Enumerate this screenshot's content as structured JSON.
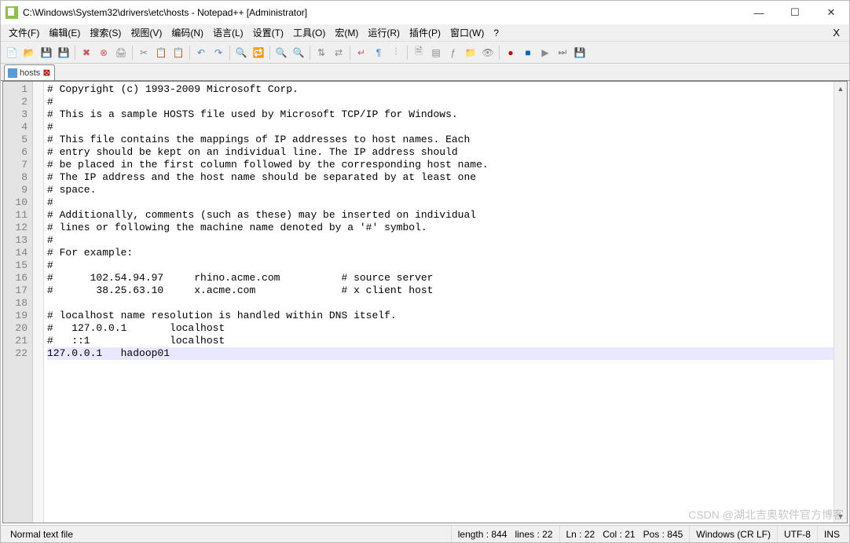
{
  "window": {
    "title": "C:\\Windows\\System32\\drivers\\etc\\hosts - Notepad++ [Administrator]"
  },
  "menubar": {
    "items": [
      "文件(F)",
      "编辑(E)",
      "搜索(S)",
      "视图(V)",
      "编码(N)",
      "语言(L)",
      "设置(T)",
      "工具(O)",
      "宏(M)",
      "运行(R)",
      "插件(P)",
      "窗口(W)",
      "?"
    ],
    "help_x": "X"
  },
  "toolbar": {
    "icons": [
      {
        "name": "new-file-icon",
        "glyph": "📄",
        "color": "#6b9"
      },
      {
        "name": "open-file-icon",
        "glyph": "📂",
        "color": "#e9a23b"
      },
      {
        "name": "save-icon",
        "glyph": "💾",
        "color": "#4a7"
      },
      {
        "name": "save-all-icon",
        "glyph": "💾",
        "color": "#4a7"
      },
      {
        "name": "sep"
      },
      {
        "name": "close-icon",
        "glyph": "✖",
        "color": "#c55"
      },
      {
        "name": "close-all-icon",
        "glyph": "⊗",
        "color": "#c55"
      },
      {
        "name": "print-icon",
        "glyph": "🖨",
        "color": "#888"
      },
      {
        "name": "sep"
      },
      {
        "name": "cut-icon",
        "glyph": "✂",
        "color": "#888"
      },
      {
        "name": "copy-icon",
        "glyph": "📋",
        "color": "#c93"
      },
      {
        "name": "paste-icon",
        "glyph": "📋",
        "color": "#c93"
      },
      {
        "name": "sep"
      },
      {
        "name": "undo-icon",
        "glyph": "↶",
        "color": "#48c"
      },
      {
        "name": "redo-icon",
        "glyph": "↷",
        "color": "#48c"
      },
      {
        "name": "sep"
      },
      {
        "name": "find-icon",
        "glyph": "🔍",
        "color": "#888"
      },
      {
        "name": "replace-icon",
        "glyph": "🔁",
        "color": "#888"
      },
      {
        "name": "sep"
      },
      {
        "name": "zoom-in-icon",
        "glyph": "🔍",
        "color": "#4a7"
      },
      {
        "name": "zoom-out-icon",
        "glyph": "🔍",
        "color": "#c55"
      },
      {
        "name": "sep"
      },
      {
        "name": "sync-v-icon",
        "glyph": "⇅",
        "color": "#888"
      },
      {
        "name": "sync-h-icon",
        "glyph": "⇄",
        "color": "#888"
      },
      {
        "name": "sep"
      },
      {
        "name": "wordwrap-icon",
        "glyph": "↵",
        "color": "#c55"
      },
      {
        "name": "all-chars-icon",
        "glyph": "¶",
        "color": "#48c"
      },
      {
        "name": "indent-guide-icon",
        "glyph": "⫶",
        "color": "#888"
      },
      {
        "name": "sep"
      },
      {
        "name": "lang-icon",
        "glyph": "🗎",
        "color": "#888"
      },
      {
        "name": "doc-map-icon",
        "glyph": "▤",
        "color": "#888"
      },
      {
        "name": "func-list-icon",
        "glyph": "ƒ",
        "color": "#888"
      },
      {
        "name": "folder-icon",
        "glyph": "📁",
        "color": "#e9a23b"
      },
      {
        "name": "monitor-icon",
        "glyph": "👁",
        "color": "#888"
      },
      {
        "name": "sep"
      },
      {
        "name": "record-icon",
        "glyph": "●",
        "color": "#c00"
      },
      {
        "name": "stop-icon",
        "glyph": "■",
        "color": "#06c"
      },
      {
        "name": "play-icon",
        "glyph": "▶",
        "color": "#888"
      },
      {
        "name": "play-multi-icon",
        "glyph": "⏭",
        "color": "#888"
      },
      {
        "name": "save-macro-icon",
        "glyph": "💾",
        "color": "#888"
      }
    ]
  },
  "tabs": [
    {
      "label": "hosts",
      "modified": true
    }
  ],
  "editor": {
    "lines": [
      "# Copyright (c) 1993-2009 Microsoft Corp.",
      "#",
      "# This is a sample HOSTS file used by Microsoft TCP/IP for Windows.",
      "#",
      "# This file contains the mappings of IP addresses to host names. Each",
      "# entry should be kept on an individual line. The IP address should",
      "# be placed in the first column followed by the corresponding host name.",
      "# The IP address and the host name should be separated by at least one",
      "# space.",
      "#",
      "# Additionally, comments (such as these) may be inserted on individual",
      "# lines or following the machine name denoted by a '#' symbol.",
      "#",
      "# For example:",
      "#",
      "#      102.54.94.97     rhino.acme.com          # source server",
      "#       38.25.63.10     x.acme.com              # x client host",
      "",
      "# localhost name resolution is handled within DNS itself.",
      "#   127.0.0.1       localhost",
      "#   ::1             localhost",
      "127.0.0.1   hadoop01"
    ],
    "current_line": 22
  },
  "statusbar": {
    "file_type": "Normal text file",
    "length_label": "length : 844",
    "lines_label": "lines : 22",
    "ln_label": "Ln : 22",
    "col_label": "Col : 21",
    "pos_label": "Pos : 845",
    "eol": "Windows (CR LF)",
    "encoding": "UTF-8",
    "ins": "INS"
  },
  "watermark": "CSDN @湖北吉奥软件官方博客"
}
